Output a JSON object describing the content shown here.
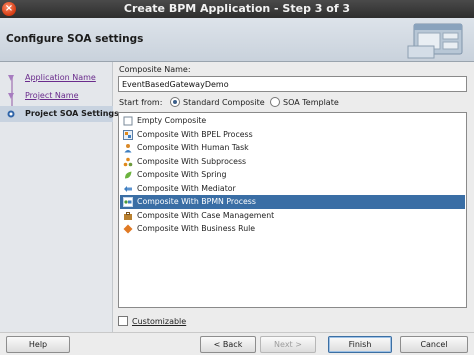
{
  "window": {
    "title": "Create BPM Application - Step 3 of 3",
    "close_glyph": "×"
  },
  "header": {
    "title": "Configure SOA settings"
  },
  "nav": {
    "items": [
      {
        "label": "Application Name",
        "state": "link"
      },
      {
        "label": "Project Name",
        "state": "link"
      },
      {
        "label": "Project SOA Settings",
        "state": "current"
      }
    ]
  },
  "form": {
    "composite_name_label": "Composite Name:",
    "composite_name_value": "EventBasedGatewayDemo",
    "start_from_label": "Start from:",
    "options": [
      {
        "label": "Standard Composite",
        "selected": true
      },
      {
        "label": "SOA Template",
        "selected": false
      }
    ],
    "templates": [
      {
        "label": "Empty Composite",
        "icon": "empty-composite-icon"
      },
      {
        "label": "Composite With BPEL Process",
        "icon": "bpel-process-icon"
      },
      {
        "label": "Composite With Human Task",
        "icon": "human-task-icon"
      },
      {
        "label": "Composite With Subprocess",
        "icon": "subprocess-icon"
      },
      {
        "label": "Composite With Spring",
        "icon": "spring-icon"
      },
      {
        "label": "Composite With Mediator",
        "icon": "mediator-icon"
      },
      {
        "label": "Composite With BPMN Process",
        "icon": "bpmn-process-icon",
        "selected": true
      },
      {
        "label": "Composite With Case Management",
        "icon": "case-management-icon"
      },
      {
        "label": "Composite With Business Rule",
        "icon": "business-rule-icon"
      }
    ],
    "customizable_label": "Customizable",
    "customizable_checked": false
  },
  "buttons": {
    "help": "Help",
    "back": "< Back",
    "next": "Next >",
    "finish": "Finish",
    "cancel": "Cancel"
  }
}
